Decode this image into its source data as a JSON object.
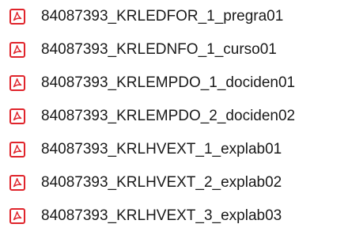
{
  "files": [
    {
      "name": "84087393_KRLEDFOR_1_pregra01",
      "icon": "pdf-icon"
    },
    {
      "name": "84087393_KRLEDNFO_1_curso01",
      "icon": "pdf-icon"
    },
    {
      "name": "84087393_KRLEMPDO_1_dociden01",
      "icon": "pdf-icon"
    },
    {
      "name": "84087393_KRLEMPDO_2_dociden02",
      "icon": "pdf-icon"
    },
    {
      "name": "84087393_KRLHVEXT_1_explab01",
      "icon": "pdf-icon"
    },
    {
      "name": "84087393_KRLHVEXT_2_explab02",
      "icon": "pdf-icon"
    },
    {
      "name": "84087393_KRLHVEXT_3_explab03",
      "icon": "pdf-icon"
    }
  ],
  "colors": {
    "icon_red": "#e0242b",
    "icon_background": "#ffffff",
    "text": "#1a1a1a"
  }
}
